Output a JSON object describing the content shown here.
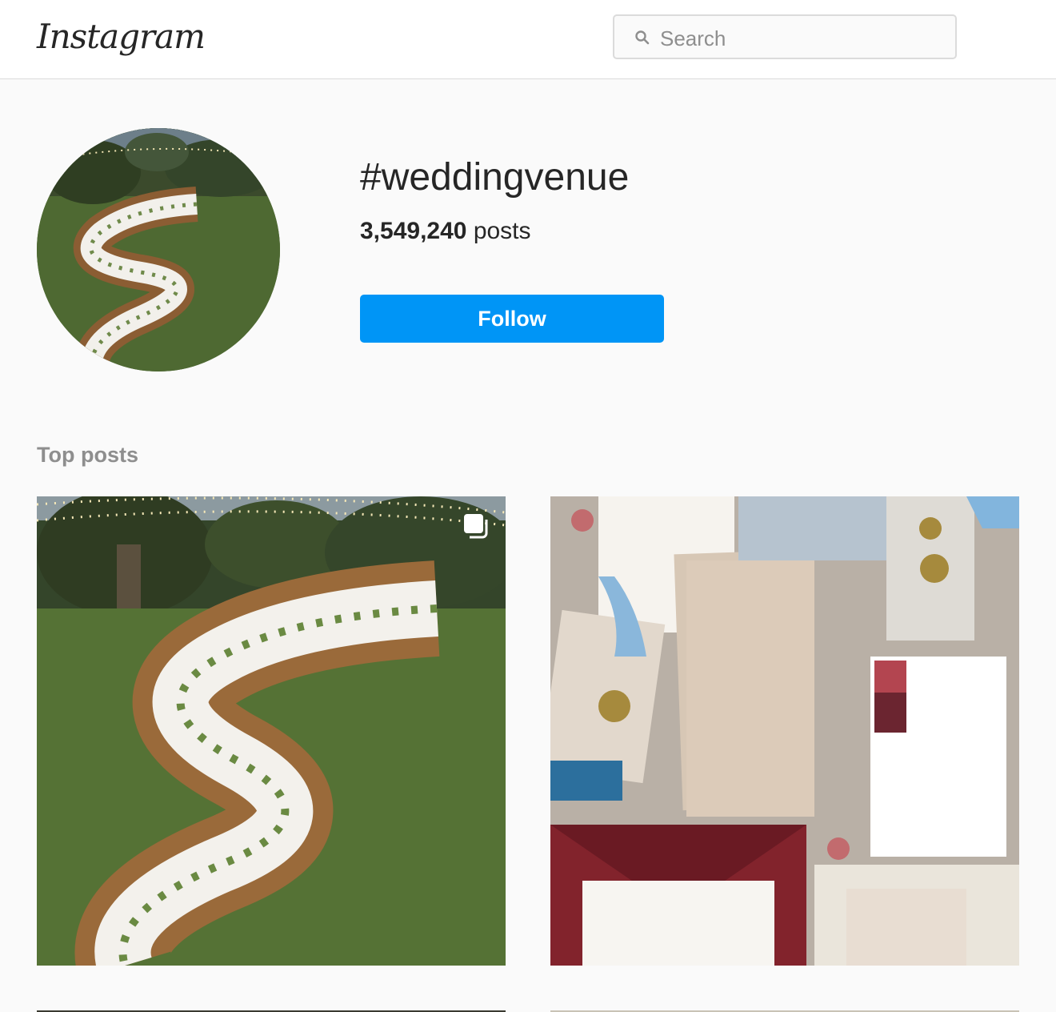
{
  "header": {
    "logo_text": "Instagram",
    "search": {
      "placeholder": "Search",
      "icon": "search-icon"
    }
  },
  "tag": {
    "name": "#weddingvenue",
    "post_count": "3,549,240",
    "post_label": "posts",
    "follow_label": "Follow"
  },
  "sections": {
    "top_posts_title": "Top posts"
  },
  "posts": [
    {
      "description": "winding-table-outdoor-wedding",
      "multiple": true
    },
    {
      "description": "wedding-stationery-flatlay",
      "multiple": false
    }
  ],
  "colors": {
    "accent": "#0095f6",
    "border": "#dbdbdb",
    "muted_text": "#8e8e8e",
    "background": "#fafafa"
  }
}
